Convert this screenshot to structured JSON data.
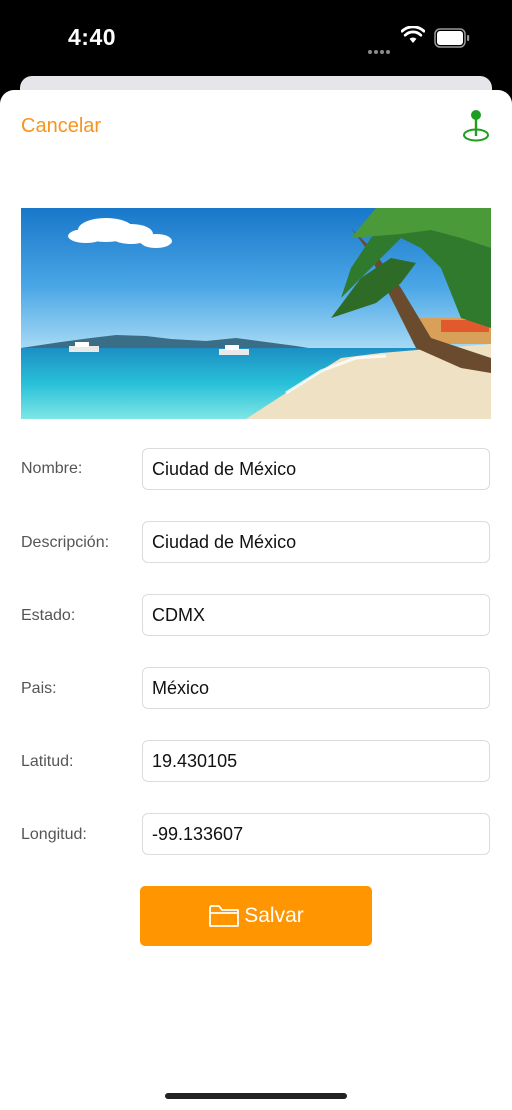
{
  "status_bar": {
    "time": "4:40"
  },
  "header": {
    "cancel_label": "Cancelar",
    "location_icon": "map-pin-icon"
  },
  "hero": {
    "alt": "Beach with palm trees and turquoise sea"
  },
  "form": {
    "fields": [
      {
        "label": "Nombre:",
        "value": "Ciudad de México"
      },
      {
        "label": "Descripción:",
        "value": "Ciudad de México"
      },
      {
        "label": "Estado:",
        "value": "CDMX"
      },
      {
        "label": "Pais:",
        "value": "México"
      },
      {
        "label": "Latitud:",
        "value": "19.430105"
      },
      {
        "label": "Longitud:",
        "value": "-99.133607"
      }
    ]
  },
  "actions": {
    "save_label": "Salvar",
    "save_icon": "folder-icon"
  },
  "colors": {
    "accent": "#F7941D",
    "button": "#FF9500",
    "pin": "#1E9E1E"
  }
}
